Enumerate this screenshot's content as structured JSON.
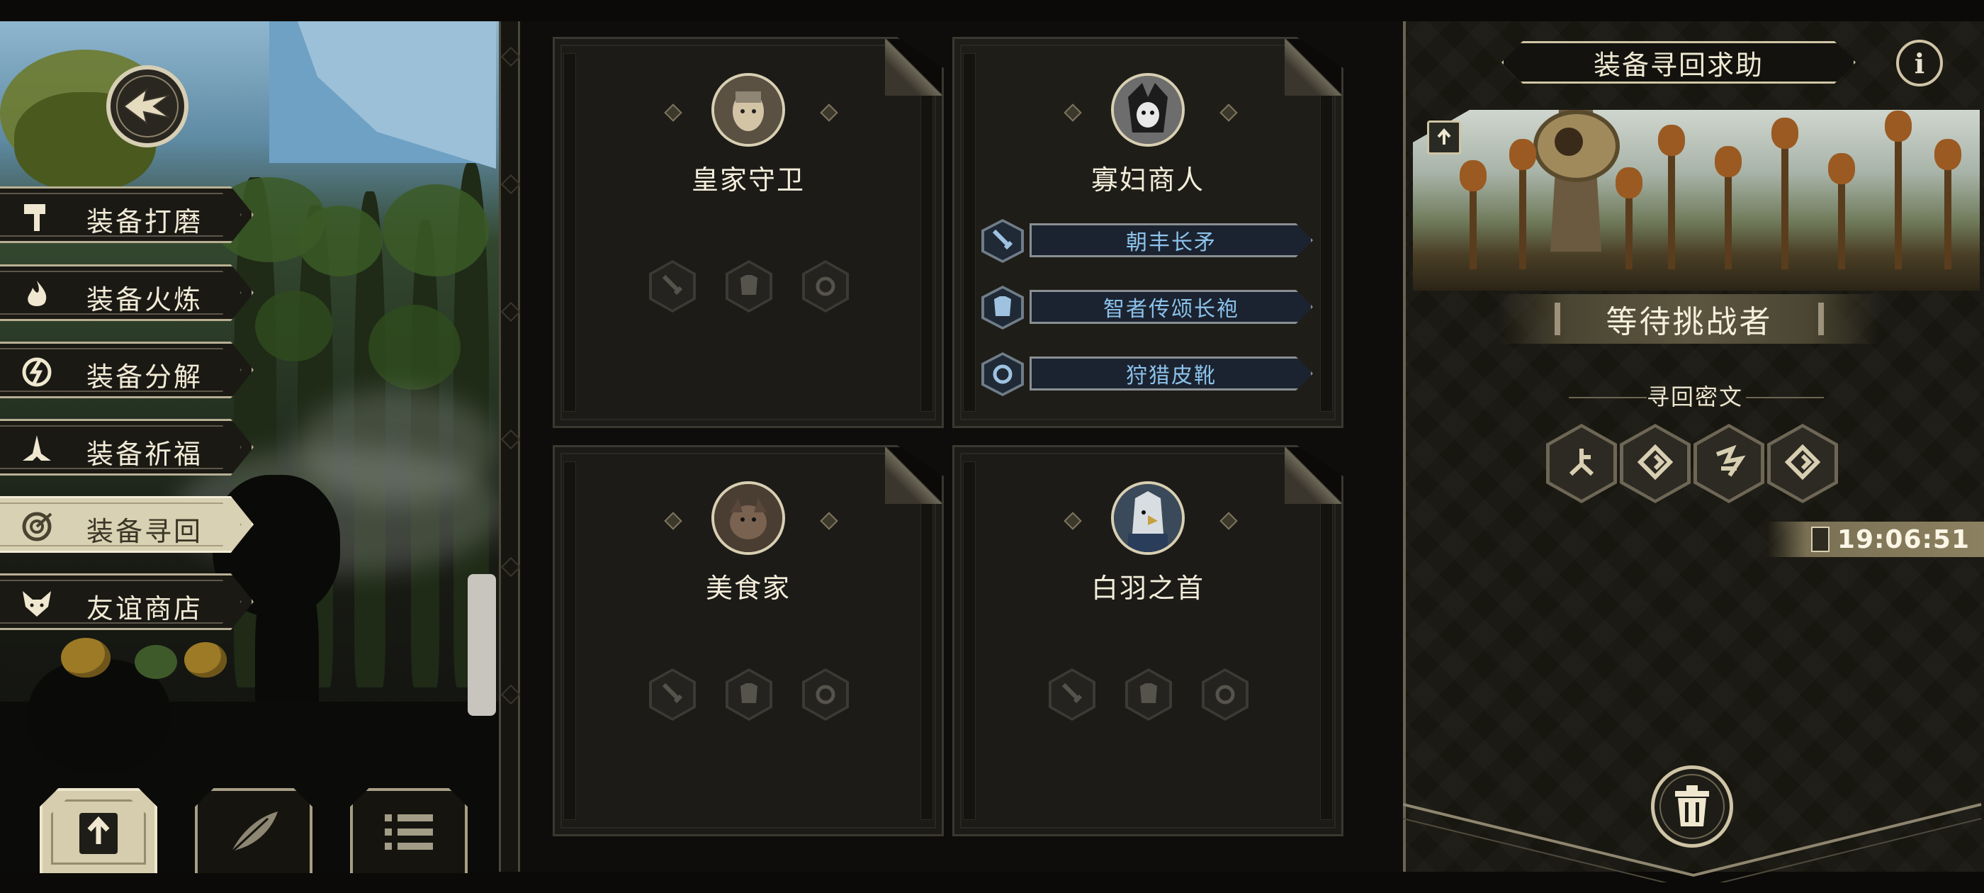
{
  "left_menu": {
    "items": [
      {
        "label": "装备打磨",
        "icon": "hammer-icon",
        "active": false
      },
      {
        "label": "装备火炼",
        "icon": "flame-icon",
        "active": false
      },
      {
        "label": "装备分解",
        "icon": "disassemble-icon",
        "active": false
      },
      {
        "label": "装备祈福",
        "icon": "praying-hands-icon",
        "active": false
      },
      {
        "label": "装备寻回",
        "icon": "recover-target-icon",
        "active": true
      },
      {
        "label": "友谊商店",
        "icon": "fox-icon",
        "active": false
      }
    ]
  },
  "bottom_tabs": [
    {
      "icon": "upload-icon",
      "active": true
    },
    {
      "icon": "feather-icon",
      "active": false
    },
    {
      "icon": "list-icon",
      "active": false
    }
  ],
  "cards": [
    {
      "name": "皇家守卫",
      "portrait": "royal-guard-portrait",
      "equipment": []
    },
    {
      "name": "寡妇商人",
      "portrait": "widow-merchant-portrait",
      "equipment": [
        {
          "label": "朝丰长矛",
          "icon": "sword-icon"
        },
        {
          "label": "智者传颂长袍",
          "icon": "armor-icon"
        },
        {
          "label": "狩猎皮靴",
          "icon": "ring-icon"
        }
      ]
    },
    {
      "name": "美食家",
      "portrait": "gourmet-portrait",
      "equipment": []
    },
    {
      "name": "白羽之首",
      "portrait": "white-feather-chief-portrait",
      "equipment": []
    }
  ],
  "right_panel": {
    "title": "装备寻回求助",
    "info_label": "i",
    "status": "等待挑战者",
    "rune_section_label": "寻回密文",
    "runes": [
      "rune-1-icon",
      "rune-2-icon",
      "rune-3-icon",
      "rune-4-icon"
    ],
    "timer": "19:06:51"
  },
  "colors": {
    "equip_text": "#8cc2ea",
    "frame_gold": "#cfc5a6",
    "active_tab": "#d9d1b3"
  }
}
